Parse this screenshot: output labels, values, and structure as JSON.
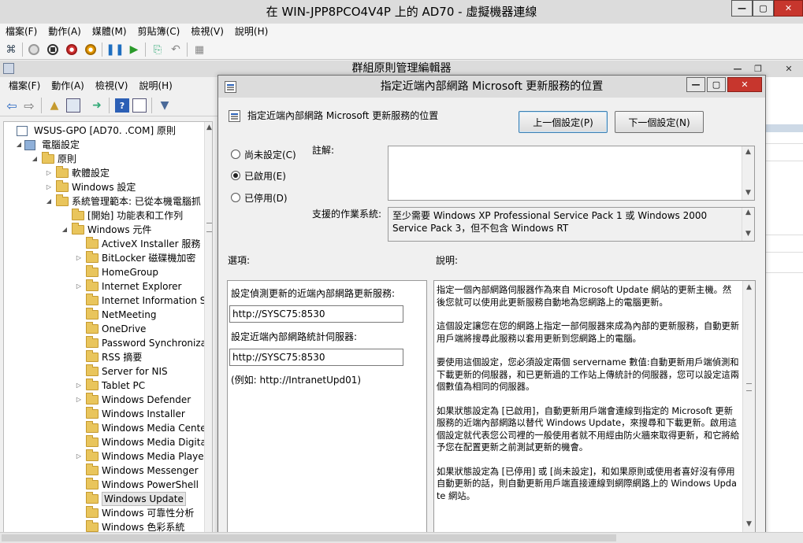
{
  "vm": {
    "title": "在 WIN-JPP8PCO4V4P 上的 AD70 - 虛擬機器連線",
    "menus": [
      "檔案(F)",
      "動作(A)",
      "媒體(M)",
      "剪貼簿(C)",
      "檢視(V)",
      "說明(H)"
    ]
  },
  "gpme": {
    "title": "群組原則管理編輯器",
    "menus": [
      "檔案(F)",
      "動作(A)",
      "檢視(V)",
      "說明(H)"
    ]
  },
  "tree": {
    "items": [
      {
        "label": "WSUS-GPO [AD70.          .COM] 原則",
        "level": 0,
        "arrow": "",
        "icon": "policy-doc-icon"
      },
      {
        "label": "電腦設定",
        "level": 1,
        "arrow": "down",
        "icon": "computer-icon"
      },
      {
        "label": "原則",
        "level": 2,
        "arrow": "down",
        "icon": "folder-icon"
      },
      {
        "label": "軟體設定",
        "level": 3,
        "arrow": "right",
        "icon": "folder-icon"
      },
      {
        "label": "Windows 設定",
        "level": 3,
        "arrow": "right",
        "icon": "folder-icon"
      },
      {
        "label": "系統管理範本: 已從本機電腦抓",
        "level": 3,
        "arrow": "down",
        "icon": "folder-icon"
      },
      {
        "label": "[開始] 功能表和工作列",
        "level": 4,
        "arrow": "",
        "icon": "folder-icon"
      },
      {
        "label": "Windows 元件",
        "level": 4,
        "arrow": "down",
        "icon": "folder-icon"
      },
      {
        "label": "ActiveX Installer 服務",
        "level": 5,
        "arrow": "",
        "icon": "folder-icon"
      },
      {
        "label": "BitLocker 磁碟機加密",
        "level": 5,
        "arrow": "right",
        "icon": "folder-icon"
      },
      {
        "label": "HomeGroup",
        "level": 5,
        "arrow": "",
        "icon": "folder-icon"
      },
      {
        "label": "Internet Explorer",
        "level": 5,
        "arrow": "right",
        "icon": "folder-icon"
      },
      {
        "label": "Internet Information Se",
        "level": 5,
        "arrow": "",
        "icon": "folder-icon"
      },
      {
        "label": "NetMeeting",
        "level": 5,
        "arrow": "",
        "icon": "folder-icon"
      },
      {
        "label": "OneDrive",
        "level": 5,
        "arrow": "",
        "icon": "folder-icon"
      },
      {
        "label": "Password Synchronizati",
        "level": 5,
        "arrow": "",
        "icon": "folder-icon"
      },
      {
        "label": "RSS 摘要",
        "level": 5,
        "arrow": "",
        "icon": "folder-icon"
      },
      {
        "label": "Server for NIS",
        "level": 5,
        "arrow": "",
        "icon": "folder-icon"
      },
      {
        "label": "Tablet PC",
        "level": 5,
        "arrow": "right",
        "icon": "folder-icon"
      },
      {
        "label": "Windows Defender",
        "level": 5,
        "arrow": "right",
        "icon": "folder-icon"
      },
      {
        "label": "Windows Installer",
        "level": 5,
        "arrow": "",
        "icon": "folder-icon"
      },
      {
        "label": "Windows Media Cente",
        "level": 5,
        "arrow": "",
        "icon": "folder-icon"
      },
      {
        "label": "Windows Media Digita",
        "level": 5,
        "arrow": "",
        "icon": "folder-icon"
      },
      {
        "label": "Windows Media Playe",
        "level": 5,
        "arrow": "right",
        "icon": "folder-icon"
      },
      {
        "label": "Windows Messenger",
        "level": 5,
        "arrow": "",
        "icon": "folder-icon"
      },
      {
        "label": "Windows PowerShell",
        "level": 5,
        "arrow": "",
        "icon": "folder-icon"
      },
      {
        "label": "Windows Update",
        "level": 5,
        "arrow": "",
        "icon": "folder-icon",
        "selected": true
      },
      {
        "label": "Windows 可靠性分析",
        "level": 5,
        "arrow": "",
        "icon": "folder-icon"
      },
      {
        "label": "Windows 色彩系統",
        "level": 5,
        "arrow": "",
        "icon": "folder-icon"
      }
    ]
  },
  "dialog": {
    "title": "指定近端內部網路 Microsoft 更新服務的位置",
    "setting_name": "指定近端內部網路 Microsoft 更新服務的位置",
    "prev_button": "上一個設定(P)",
    "next_button": "下一個設定(N)",
    "radios": {
      "not_configured": "尚未設定(C)",
      "enabled": "已啟用(E)",
      "disabled": "已停用(D)",
      "selected": "enabled"
    },
    "comment_label": "註解:",
    "comment_value": "",
    "supported_label": "支援的作業系統:",
    "supported_value": "至少需要 Windows XP Professional Service Pack 1 或 Windows 2000 Service Pack 3，但不包含 Windows RT",
    "options_label": "選項:",
    "help_label": "說明:",
    "options": {
      "update_server_label": "設定偵測更新的近端內部網路更新服務:",
      "update_server_value": "http://SYSC75:8530",
      "stats_server_label": "設定近端內部網路統計伺服器:",
      "stats_server_value": "http://SYSC75:8530",
      "example": "(例如: http://IntranetUpd01)"
    },
    "help_paragraphs": [
      "指定一個內部網路伺服器作為來自 Microsoft Update 網站的更新主機。然後您就可以使用此更新服務自動地為您網路上的電腦更新。",
      "這個設定讓您在您的網路上指定一部伺服器來成為內部的更新服務，自動更新用戶端將搜尋此服務以套用更新到您網路上的電腦。",
      "要使用這個設定，您必須設定兩個 servername 數值:自動更新用戶端偵測和下載更新的伺服器，和已更新過的工作站上傳統計的伺服器，您可以設定這兩個數值為相同的伺服器。",
      "如果狀態設定為 [已啟用]，自動更新用戶端會連線到指定的 Microsoft 更新服務的近端內部網路以替代 Windows Update，來搜尋和下載更新。啟用這個設定就代表您公司裡的一般使用者就不用經由防火牆來取得更新，和它將給予您在配置更新之前測試更新的機會。",
      "如果狀態設定為 [已停用] 或 [尚未設定]，和如果原則或使用者喜好沒有停用自動更新的話，則自動更新用戶端直接連線到網際網路上的 Windows Update 網站。"
    ]
  }
}
